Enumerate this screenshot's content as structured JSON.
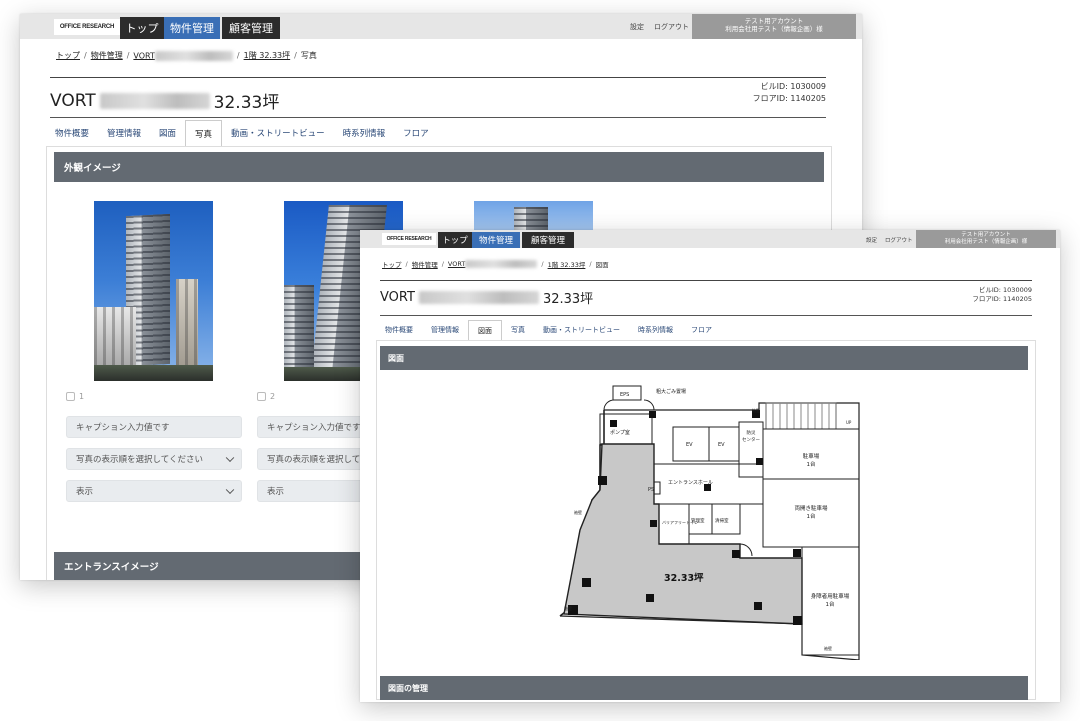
{
  "header": {
    "logo": "OFFICE RESEARCH",
    "nav": [
      "トップ",
      "物件管理",
      "顧客管理"
    ],
    "links": [
      "設定",
      "ログアウト"
    ],
    "user_line1": "テスト用アカウント",
    "user_line2": "利用会社用テスト（情報企画）様"
  },
  "breadcrumb": {
    "top": "トップ",
    "property_mgmt": "物件管理",
    "building_prefix": "VORT",
    "floor": "1階 32.33坪",
    "back_current": "写真",
    "front_current": "図面"
  },
  "title": {
    "prefix": "VORT",
    "suffix": "32.33坪"
  },
  "ids": {
    "building": "ビルID: 1030009",
    "floor": "フロアID: 1140205"
  },
  "tabs": [
    "物件概要",
    "管理情報",
    "図面",
    "写真",
    "動画・ストリートビュー",
    "時系列情報",
    "フロア"
  ],
  "back_window": {
    "active_tab": "写真",
    "section_exterior": "外観イメージ",
    "section_entrance": "エントランスイメージ",
    "photos": [
      {
        "number": "1",
        "caption_placeholder": "キャプション入力値です",
        "order_select": "写真の表示順を選択してください",
        "display_select": "表示"
      },
      {
        "number": "2",
        "caption_placeholder": "キャプション入力値です",
        "order_select": "写真の表示順を選択して",
        "display_select": "表示"
      }
    ]
  },
  "front_window": {
    "active_tab": "図面",
    "section_drawing": "図面",
    "section_management": "図面の管理",
    "floor_plan": {
      "area_label": "32.33坪",
      "rooms": {
        "eps": "EPS",
        "garbage": "粗大ごみ置場",
        "pump": "ポンプ室",
        "ps": "PS",
        "ev1": "EV",
        "ev2": "EV",
        "disaster": "防災センター",
        "parking_car": "駐車場\n1台",
        "hall": "エントランスホール",
        "bicycle": "両開き駐車場\n1台",
        "barrier_free": "バリアフリートイレ",
        "manager": "管理室",
        "cleaning": "清掃室",
        "accessible_parking": "身障者用駐車場\n1台"
      },
      "markers": {
        "up": "UP",
        "wall": "袖壁"
      }
    }
  },
  "colors": {
    "accent_blue": "#3a6fb6",
    "nav_dark": "#2c2c2c",
    "section_header": "#636a72"
  }
}
